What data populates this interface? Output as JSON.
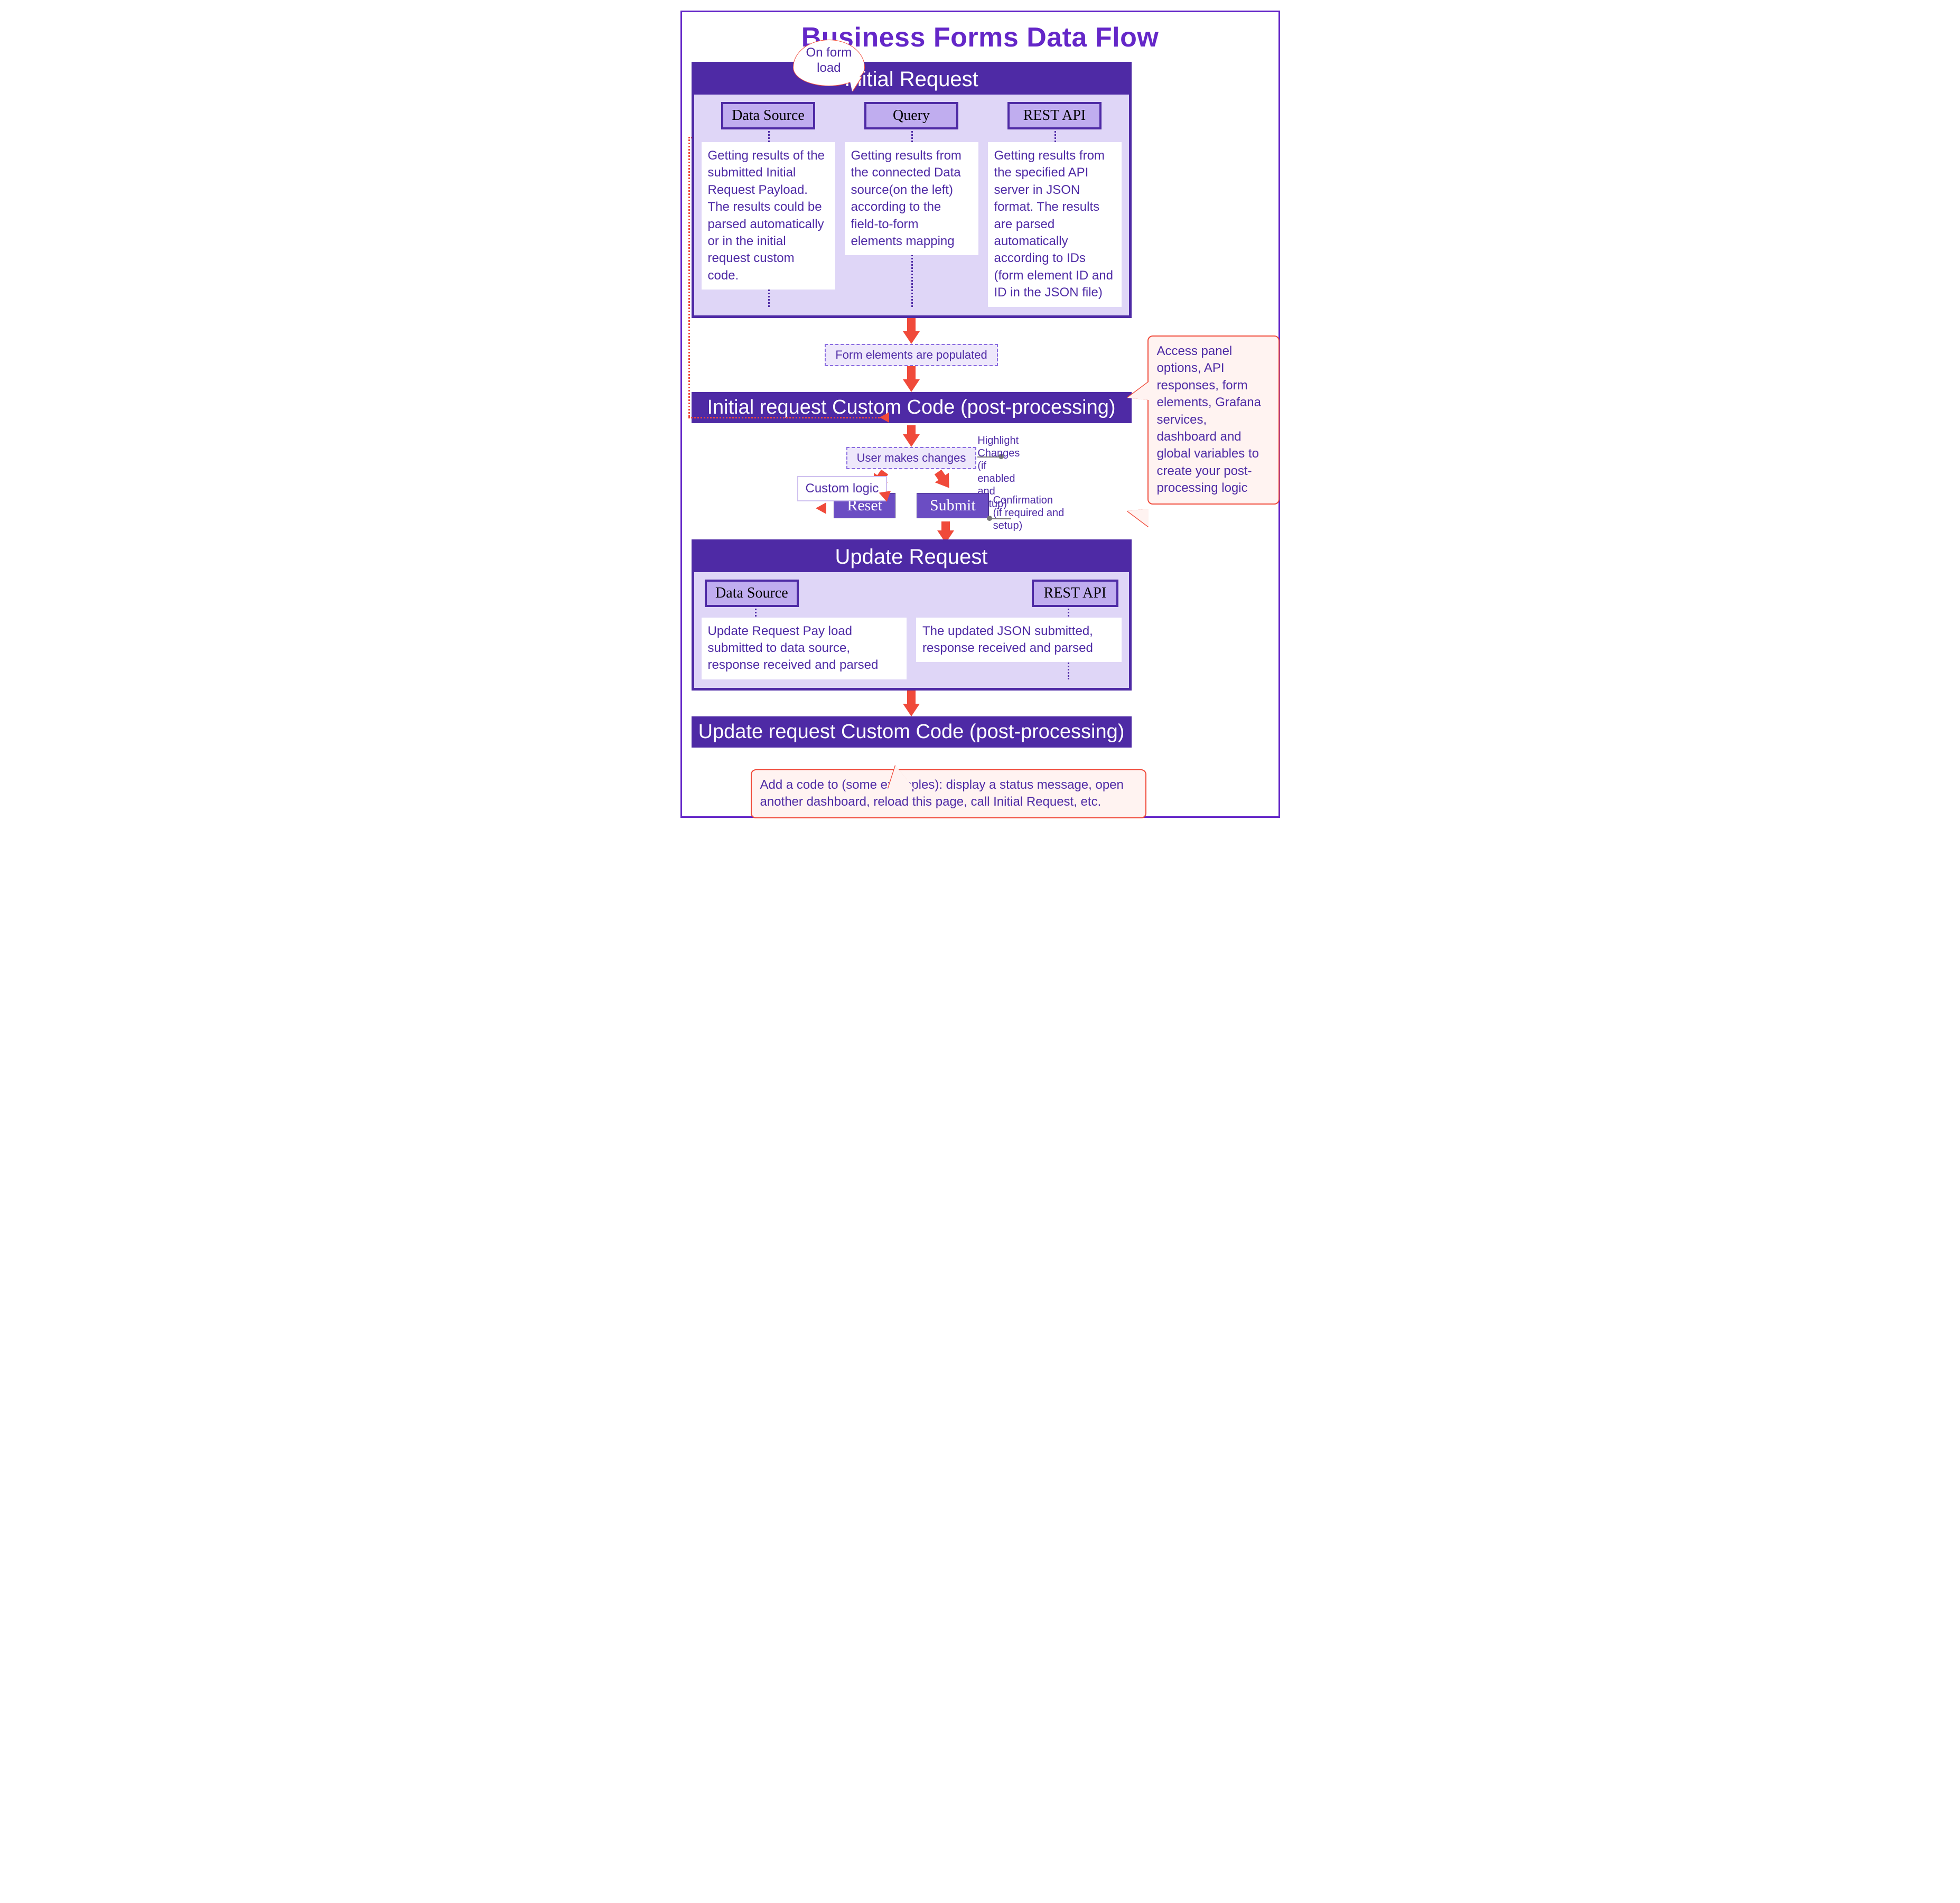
{
  "title": "Business Forms Data Flow",
  "on_form_load": "On form\nload",
  "initial_request": {
    "header": "Initial Request",
    "cols": [
      {
        "title": "Data Source",
        "desc": "Getting results of the submitted Initial Request Payload. The results could be parsed automatically or in the initial request custom code."
      },
      {
        "title": "Query",
        "desc": "Getting results from the connected Data source(on the left) according to the field-to-form elements mapping"
      },
      {
        "title": "REST API",
        "desc": "Getting results from the specified API server in JSON format. The results are parsed automatically according to IDs (form element ID and ID in the JSON file)"
      }
    ]
  },
  "populated_note": "Form elements are populated",
  "initial_custom_code_bar": "Initial request Custom Code (post-processing)",
  "custom_logic": "Custom logic",
  "user_changes": "User makes changes",
  "btn_reset": "Reset",
  "btn_submit": "Submit",
  "highlight_label": "Highlight Changes\n(if enabled and setup)",
  "confirmation_label": "Confirmation\n(if required and setup)",
  "update_request": {
    "header": "Update Request",
    "cols": [
      {
        "title": "Data Source",
        "desc": "Update Request Pay load submitted to data source, response received and parsed"
      },
      {
        "title": "REST API",
        "desc": "The updated JSON submitted, response received and parsed"
      }
    ]
  },
  "update_custom_code_bar": "Update request Custom Code (post-processing)",
  "callout_right": "Access panel options, API responses, form elements, Grafana services, dashboard and global variables to create your post-processing logic",
  "callout_bottom": "Add a code to (some examples): display a status message, open another dashboard, reload this page, call Initial Request, etc."
}
